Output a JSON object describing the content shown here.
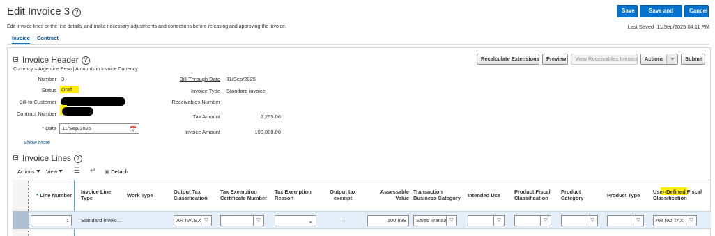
{
  "header": {
    "title": "Edit Invoice 3",
    "subtitle": "Edit invoice lines or the line details, and make necessary adjustments and corrections before releasing and approving the invoice.",
    "last_saved_label": "Last Saved",
    "last_saved_value": "11/Sep/2025 04:11 PM",
    "buttons": {
      "save": "Save",
      "save_close": "Save and Close",
      "cancel": "Cancel"
    }
  },
  "tabs": [
    {
      "label": "Invoice",
      "active": true
    },
    {
      "label": "Contract",
      "active": false
    }
  ],
  "invoice_header": {
    "title": "Invoice Header",
    "currency_note": "Currency = Argentine Peso | Amounts in Invoice Currency",
    "buttons": {
      "recalc": "Recalculate Extensions",
      "preview": "Preview",
      "view_receivables": "View Receivables Invoice",
      "actions": "Actions",
      "submit": "Submit"
    },
    "fields": {
      "number_label": "Number",
      "number_value": "3",
      "status_label": "Status",
      "status_value": "Draft",
      "bill_to_label": "Bill-to Customer",
      "contract_label": "Contract Number",
      "date_label": "Date",
      "date_value": "11/Sep/2025",
      "bill_through_label": "Bill-Through Date",
      "bill_through_value": "11/Sep/2025",
      "invoice_type_label": "Invoice Type",
      "invoice_type_value": "Standard invoice",
      "receivables_label": "Receivables Number",
      "tax_amount_label": "Tax Amount",
      "tax_amount_value": "6,255.06",
      "invoice_amount_label": "Invoice Amount",
      "invoice_amount_value": "100,888.00"
    },
    "show_more": "Show More"
  },
  "invoice_lines": {
    "title": "Invoice Lines",
    "toolbar": {
      "actions": "Actions",
      "view": "View",
      "detach": "Detach"
    },
    "columns": [
      "Line Number",
      "Invoice Line Type",
      "Work Type",
      "Output Tax Classification",
      "Tax Exemption Certificate Number",
      "Tax Exemption Reason",
      "Output tax exempt",
      "Assessable Value",
      "Transaction Business Category",
      "Intended Use",
      "Product Fiscal Classification",
      "Product Category",
      "Product Type",
      "User-Defined Fiscal Classification"
    ],
    "row": {
      "line_number": "1",
      "line_type": "Standard invoic…",
      "output_tax": "AR IVA EX",
      "output_tax_exempt": "…",
      "assessable_value": "100,888",
      "business_category": "Sales Transac",
      "user_defined": "AR NO TAX"
    }
  },
  "colors": {
    "accent": "#0572ce",
    "highlight": "#ffee00",
    "row_band": "#e4eef8"
  }
}
